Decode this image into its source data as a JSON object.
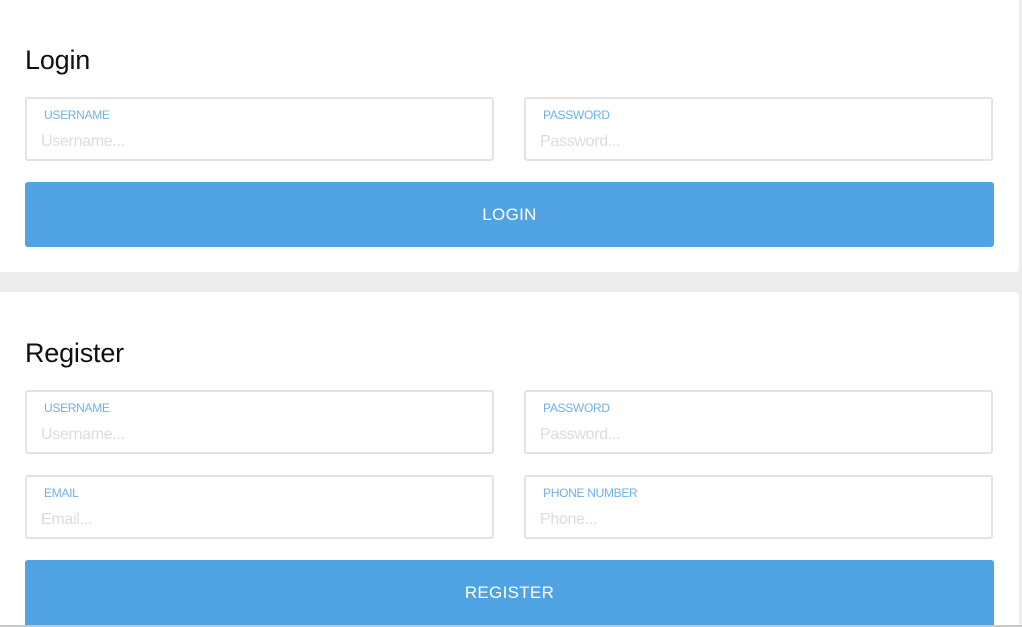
{
  "login": {
    "title": "Login",
    "username": {
      "label": "USERNAME",
      "placeholder": "Username...",
      "value": ""
    },
    "password": {
      "label": "PASSWORD",
      "placeholder": "Password...",
      "value": ""
    },
    "button_label": "LOGIN"
  },
  "register": {
    "title": "Register",
    "username": {
      "label": "USERNAME",
      "placeholder": "Username...",
      "value": ""
    },
    "password": {
      "label": "PASSWORD",
      "placeholder": "Password...",
      "value": ""
    },
    "email": {
      "label": "EMAIL",
      "placeholder": "Email...",
      "value": ""
    },
    "phone": {
      "label": "PHONE NUMBER",
      "placeholder": "Phone...",
      "value": ""
    },
    "button_label": "REGISTER"
  },
  "colors": {
    "accent": "#50a3e2",
    "label": "#6fb0e8",
    "placeholder": "#d9dde2",
    "page_background": "#ededed",
    "card_background": "#ffffff"
  }
}
